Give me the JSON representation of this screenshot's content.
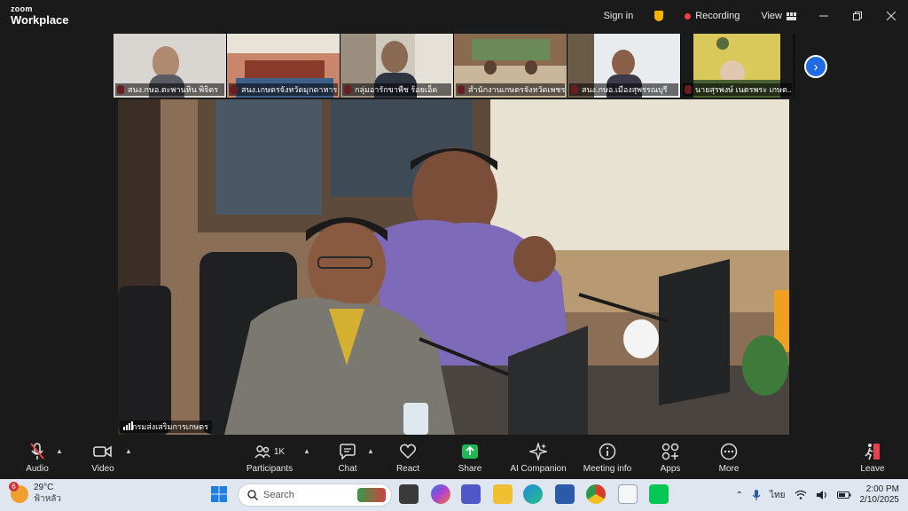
{
  "window": {
    "brand_top": "zoom",
    "brand_bottom": "Workplace",
    "sign_in": "Sign in",
    "recording": "Recording",
    "view": "View",
    "accent": "#1f6be6",
    "recording_color": "#e8414b"
  },
  "thumbnails": [
    {
      "name": "สนง.กษอ.ตะพานหิน พิจิตร",
      "bg": "#d9d6d2"
    },
    {
      "name": "สนง.เกษตรจังหวัดมุกดาหาร",
      "bg": "#b86a4a"
    },
    {
      "name": "กลุ่มอารักขาพืช ร้อยเอ็ด",
      "bg": "#c9c2b8"
    },
    {
      "name": "สำนักงานเกษตรจังหวัดเพชรบ",
      "bg": "#8a6a50"
    },
    {
      "name": "สนง.กษอ.เมืองสุพรรณบุรี",
      "bg": "#e9ecef"
    },
    {
      "name": "นายสุรพงษ์ เนตรพระ เกษต...",
      "bg": "#d8c95a"
    }
  ],
  "main_video": {
    "speaker_label": "กรมส่งเสริมการเกษตร"
  },
  "toolbar": {
    "audio": "Audio",
    "video": "Video",
    "participants": "Participants",
    "participant_count": "1K",
    "chat": "Chat",
    "react": "React",
    "share": "Share",
    "ai_companion": "AI Companion",
    "meeting_info": "Meeting info",
    "apps": "Apps",
    "more": "More",
    "leave": "Leave"
  },
  "taskbar": {
    "temperature": "29°C",
    "weather_text": "ฟ้าหลัว",
    "weather_badge": "6",
    "search_placeholder": "Search",
    "language": "ไทย",
    "time": "2:00 PM",
    "date": "2/10/2025"
  }
}
